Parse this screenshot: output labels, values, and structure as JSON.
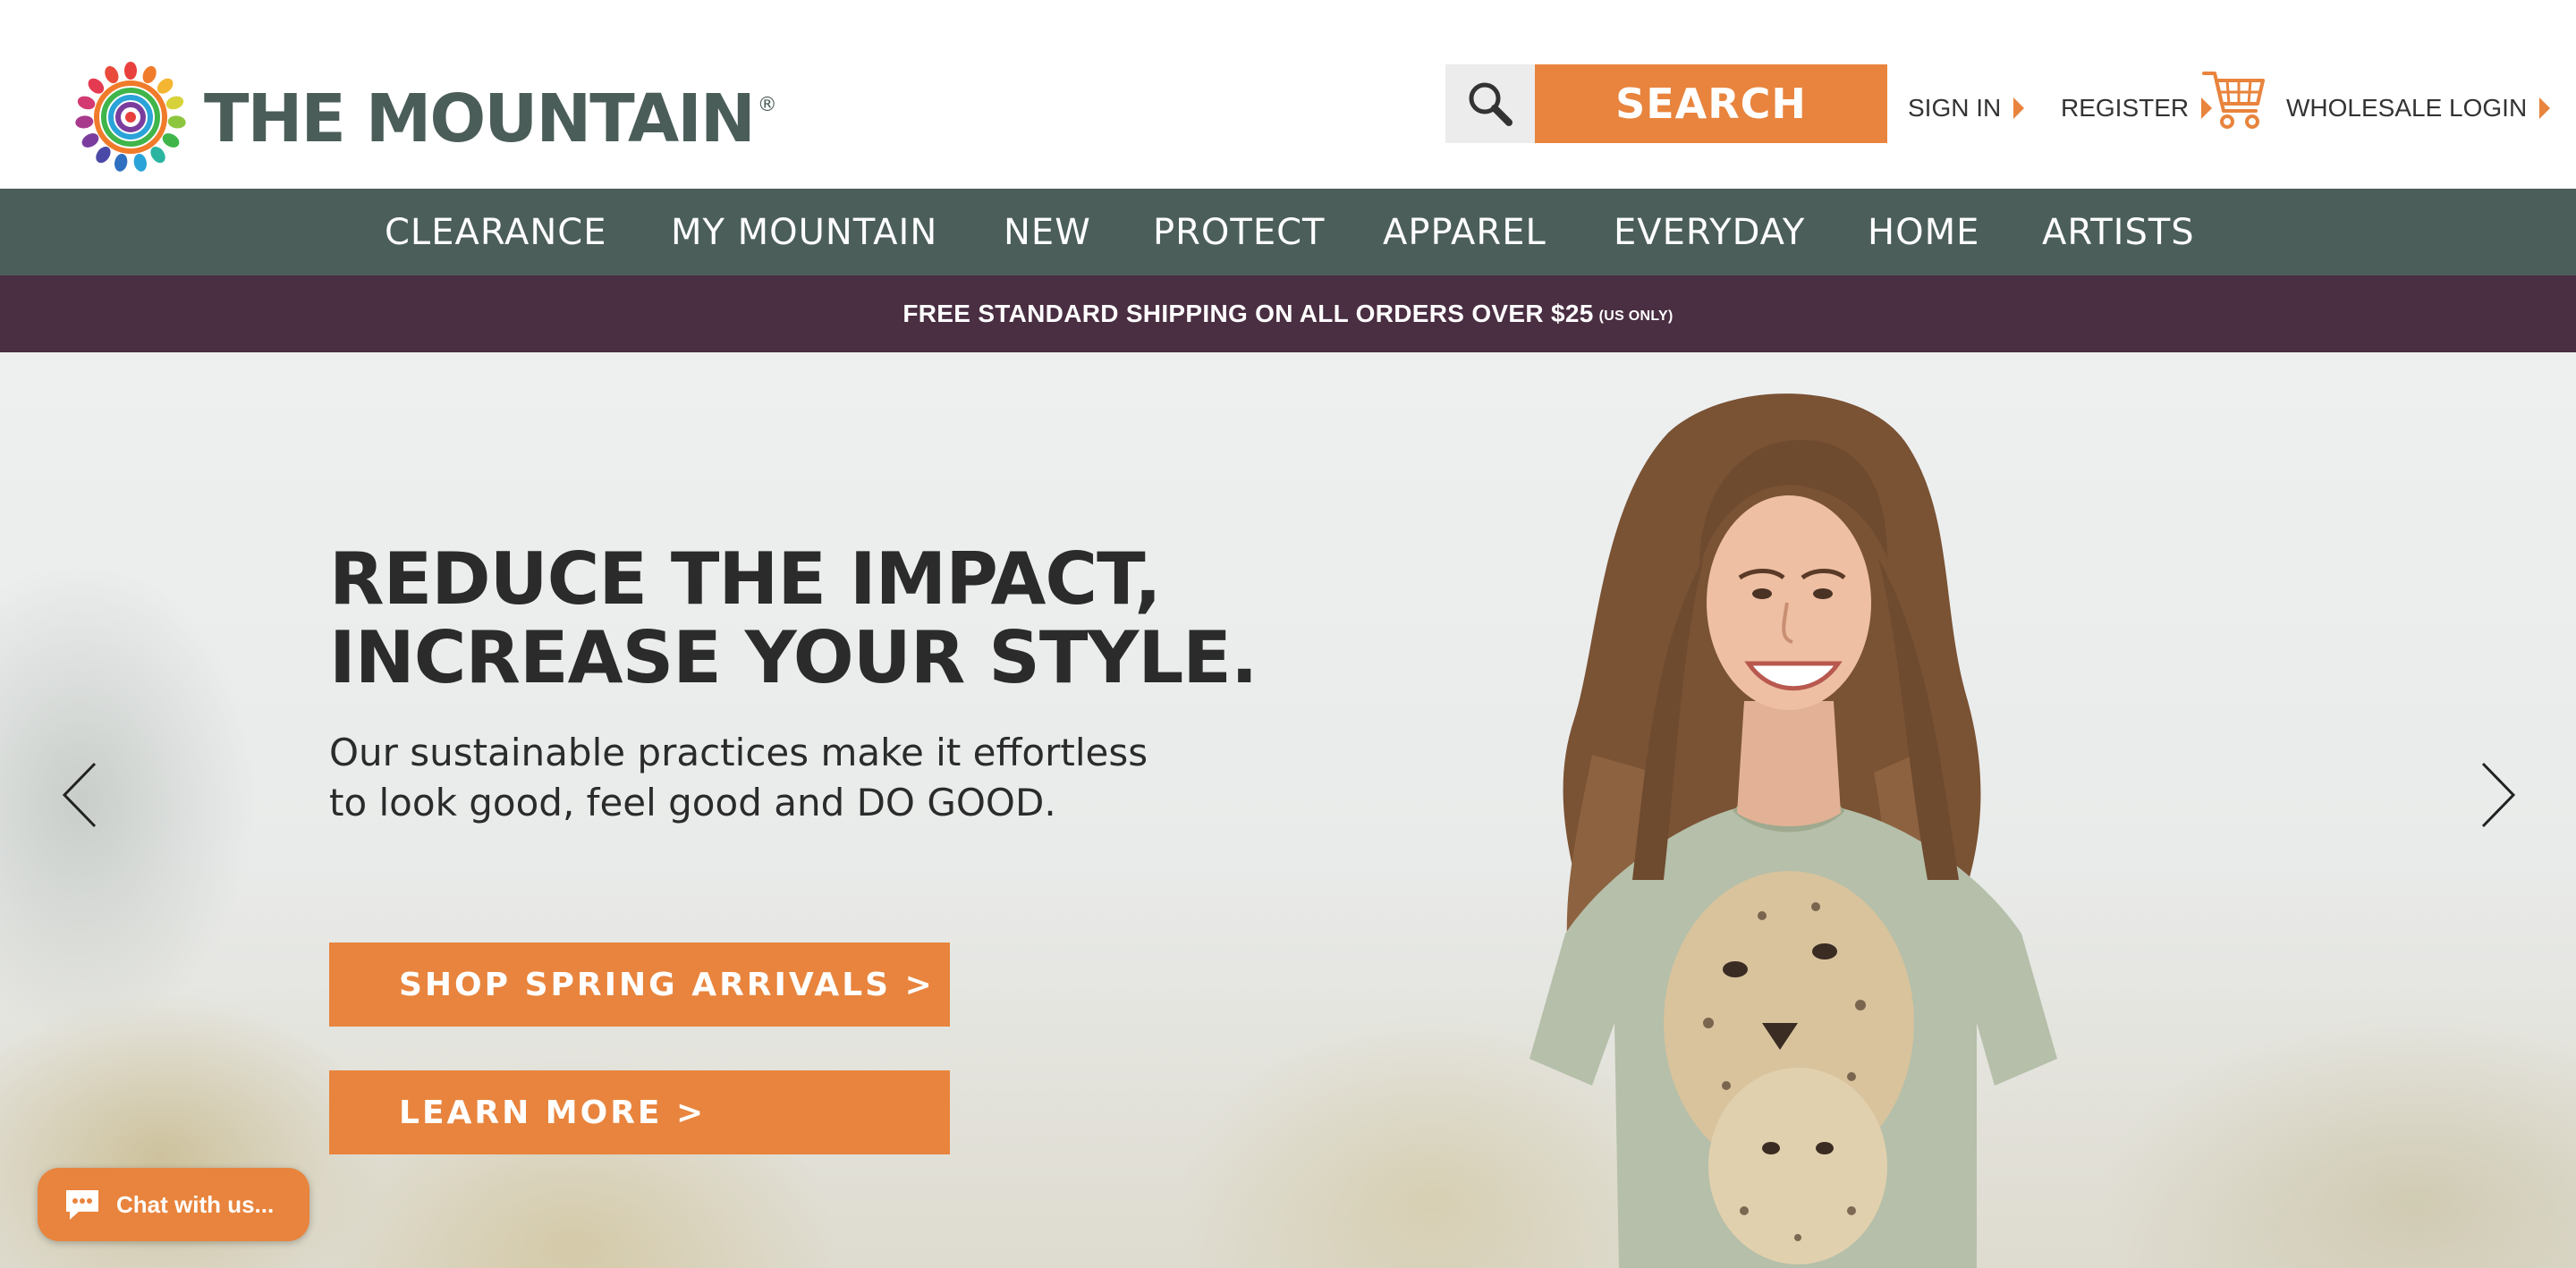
{
  "brand": {
    "name": "THE MOUNTAIN",
    "registered_mark": "®"
  },
  "header": {
    "search_button_label": "SEARCH",
    "links": {
      "sign_in": "SIGN IN",
      "register": "REGISTER",
      "wholesale_login": "WHOLESALE LOGIN"
    },
    "icons": [
      "search-icon",
      "cart-icon",
      "arrow-right-icon"
    ]
  },
  "nav": {
    "items": [
      "CLEARANCE",
      "MY MOUNTAIN",
      "NEW",
      "PROTECT",
      "APPAREL",
      "EVERYDAY",
      "HOME",
      "ARTISTS"
    ]
  },
  "promo": {
    "text": "FREE STANDARD SHIPPING ON ALL ORDERS OVER $25",
    "note": "(US ONLY)"
  },
  "hero": {
    "headline_line1": "REDUCE THE IMPACT,",
    "headline_line2": "INCREASE YOUR STYLE.",
    "sub_line1": "Our sustainable practices make it effortless",
    "sub_line2": "to look good, feel good and DO GOOD.",
    "cta_primary": "SHOP SPRING ARRIVALS >",
    "cta_secondary": "LEARN MORE >",
    "icons": [
      "chevron-left-icon",
      "chevron-right-icon"
    ]
  },
  "chat": {
    "label": "Chat with us...",
    "icon": "chat-bubble-icon"
  },
  "colors": {
    "accent_orange": "#e8843d",
    "nav_green": "#4b5e5a",
    "promo_purple": "#4a2e42",
    "logo_text": "#4a5d59"
  }
}
